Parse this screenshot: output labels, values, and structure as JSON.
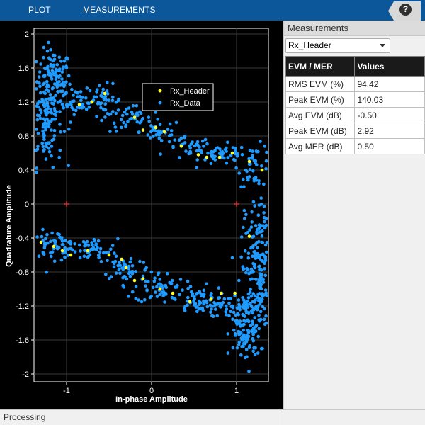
{
  "toolstrip": {
    "tabs": [
      "PLOT",
      "MEASUREMENTS"
    ],
    "help_icon": "help-icon",
    "help_label": "?"
  },
  "colors": {
    "toolstrip": "#0b5799",
    "rx_header": "#ffff33",
    "rx_data": "#1f9bff",
    "reference": "#ff3030",
    "plot_bg": "#000000"
  },
  "chart_data": {
    "type": "scatter",
    "xlabel": "In-phase Amplitude",
    "ylabel": "Quadrature Amplitude",
    "xlim": [
      -1.4,
      1.4
    ],
    "ylim": [
      -2.1,
      2.1
    ],
    "xticks": [
      -1,
      0,
      1
    ],
    "xtick_labels": [
      "-1",
      "0",
      "1"
    ],
    "yticks": [
      2,
      1.6,
      1.2,
      0.8,
      0.4,
      0,
      -0.4,
      -0.8,
      -1.2,
      -1.6,
      -2
    ],
    "ytick_labels": [
      "2",
      "1.6",
      "1.2",
      "0.8",
      "0.4",
      "0",
      "-0.4",
      "-0.8",
      "-1.2",
      "-1.6",
      "-2"
    ],
    "grid": true,
    "legend_position": "top-center",
    "reference_constellation": [
      [
        -1,
        0
      ],
      [
        1,
        0
      ]
    ],
    "series": [
      {
        "name": "Rx_Header",
        "color": "#ffff33",
        "points": [
          [
            -0.85,
            1.17
          ],
          [
            -0.7,
            1.2
          ],
          [
            -0.55,
            1.3
          ],
          [
            -0.2,
            1.02
          ],
          [
            -0.1,
            0.87
          ],
          [
            0.05,
            0.9
          ],
          [
            0.15,
            0.85
          ],
          [
            0.35,
            0.68
          ],
          [
            0.55,
            0.58
          ],
          [
            0.65,
            0.55
          ],
          [
            0.8,
            0.55
          ],
          [
            0.95,
            0.6
          ],
          [
            1.15,
            0.5
          ],
          [
            1.3,
            0.4
          ],
          [
            -1.3,
            -0.45
          ],
          [
            -1.15,
            -0.5
          ],
          [
            -1.05,
            -0.55
          ],
          [
            -0.95,
            -0.6
          ],
          [
            -0.75,
            -0.55
          ],
          [
            -0.3,
            -0.75
          ],
          [
            -0.2,
            -0.9
          ],
          [
            -0.1,
            -0.88
          ],
          [
            0.1,
            -1.0
          ],
          [
            0.25,
            -1.05
          ],
          [
            0.45,
            -1.15
          ],
          [
            0.7,
            -1.12
          ],
          [
            0.82,
            -1.05
          ],
          [
            0.98,
            -1.05
          ],
          [
            -0.35,
            -0.65
          ],
          [
            -0.5,
            -0.6
          ],
          [
            1.15,
            -0.38
          ]
        ]
      },
      {
        "name": "Rx_Data",
        "color": "#1f9bff",
        "clusters": [
          {
            "cx": -1.15,
            "cy": 1.45,
            "sx": 0.1,
            "sy": 0.18,
            "n": 120
          },
          {
            "cx": -1.25,
            "cy": 0.95,
            "sx": 0.1,
            "sy": 0.25,
            "n": 110
          },
          {
            "cx": -0.85,
            "cy": 1.2,
            "sx": 0.1,
            "sy": 0.07,
            "n": 40
          },
          {
            "cx": -0.55,
            "cy": 1.22,
            "sx": 0.1,
            "sy": 0.09,
            "n": 40
          },
          {
            "cx": -0.25,
            "cy": 1.0,
            "sx": 0.12,
            "sy": 0.08,
            "n": 40
          },
          {
            "cx": 0.1,
            "cy": 0.85,
            "sx": 0.12,
            "sy": 0.07,
            "n": 35
          },
          {
            "cx": 0.45,
            "cy": 0.65,
            "sx": 0.13,
            "sy": 0.07,
            "n": 35
          },
          {
            "cx": 0.85,
            "cy": 0.58,
            "sx": 0.14,
            "sy": 0.06,
            "n": 45
          },
          {
            "cx": 1.22,
            "cy": 0.45,
            "sx": 0.1,
            "sy": 0.12,
            "n": 45
          },
          {
            "cx": -1.15,
            "cy": -0.48,
            "sx": 0.15,
            "sy": 0.08,
            "n": 60
          },
          {
            "cx": -0.7,
            "cy": -0.55,
            "sx": 0.15,
            "sy": 0.07,
            "n": 45
          },
          {
            "cx": -0.3,
            "cy": -0.75,
            "sx": 0.14,
            "sy": 0.08,
            "n": 50
          },
          {
            "cx": 0.1,
            "cy": -0.98,
            "sx": 0.15,
            "sy": 0.09,
            "n": 60
          },
          {
            "cx": 0.55,
            "cy": -1.15,
            "sx": 0.15,
            "sy": 0.09,
            "n": 70
          },
          {
            "cx": 1.0,
            "cy": -1.2,
            "sx": 0.1,
            "sy": 0.07,
            "n": 50
          },
          {
            "cx": 1.1,
            "cy": -1.55,
            "sx": 0.09,
            "sy": 0.16,
            "n": 85
          },
          {
            "cx": 1.25,
            "cy": -0.75,
            "sx": 0.1,
            "sy": 0.3,
            "n": 140
          },
          {
            "cx": 1.32,
            "cy": -0.2,
            "sx": 0.06,
            "sy": 0.18,
            "n": 30
          },
          {
            "cx": 1.3,
            "cy": -1.2,
            "sx": 0.08,
            "sy": 0.14,
            "n": 50
          }
        ]
      }
    ]
  },
  "measurements": {
    "title": "Measurements",
    "source_selected": "Rx_Header",
    "headers": [
      "EVM / MER",
      "Values"
    ],
    "rows": [
      {
        "label": "RMS EVM (%)",
        "value": "94.42"
      },
      {
        "label": "Peak EVM (%)",
        "value": "140.03"
      },
      {
        "label": "Avg EVM (dB)",
        "value": "-0.50"
      },
      {
        "label": "Peak EVM (dB)",
        "value": "2.92"
      },
      {
        "label": "Avg MER (dB)",
        "value": "0.50"
      }
    ]
  },
  "status": {
    "text": "Processing"
  }
}
